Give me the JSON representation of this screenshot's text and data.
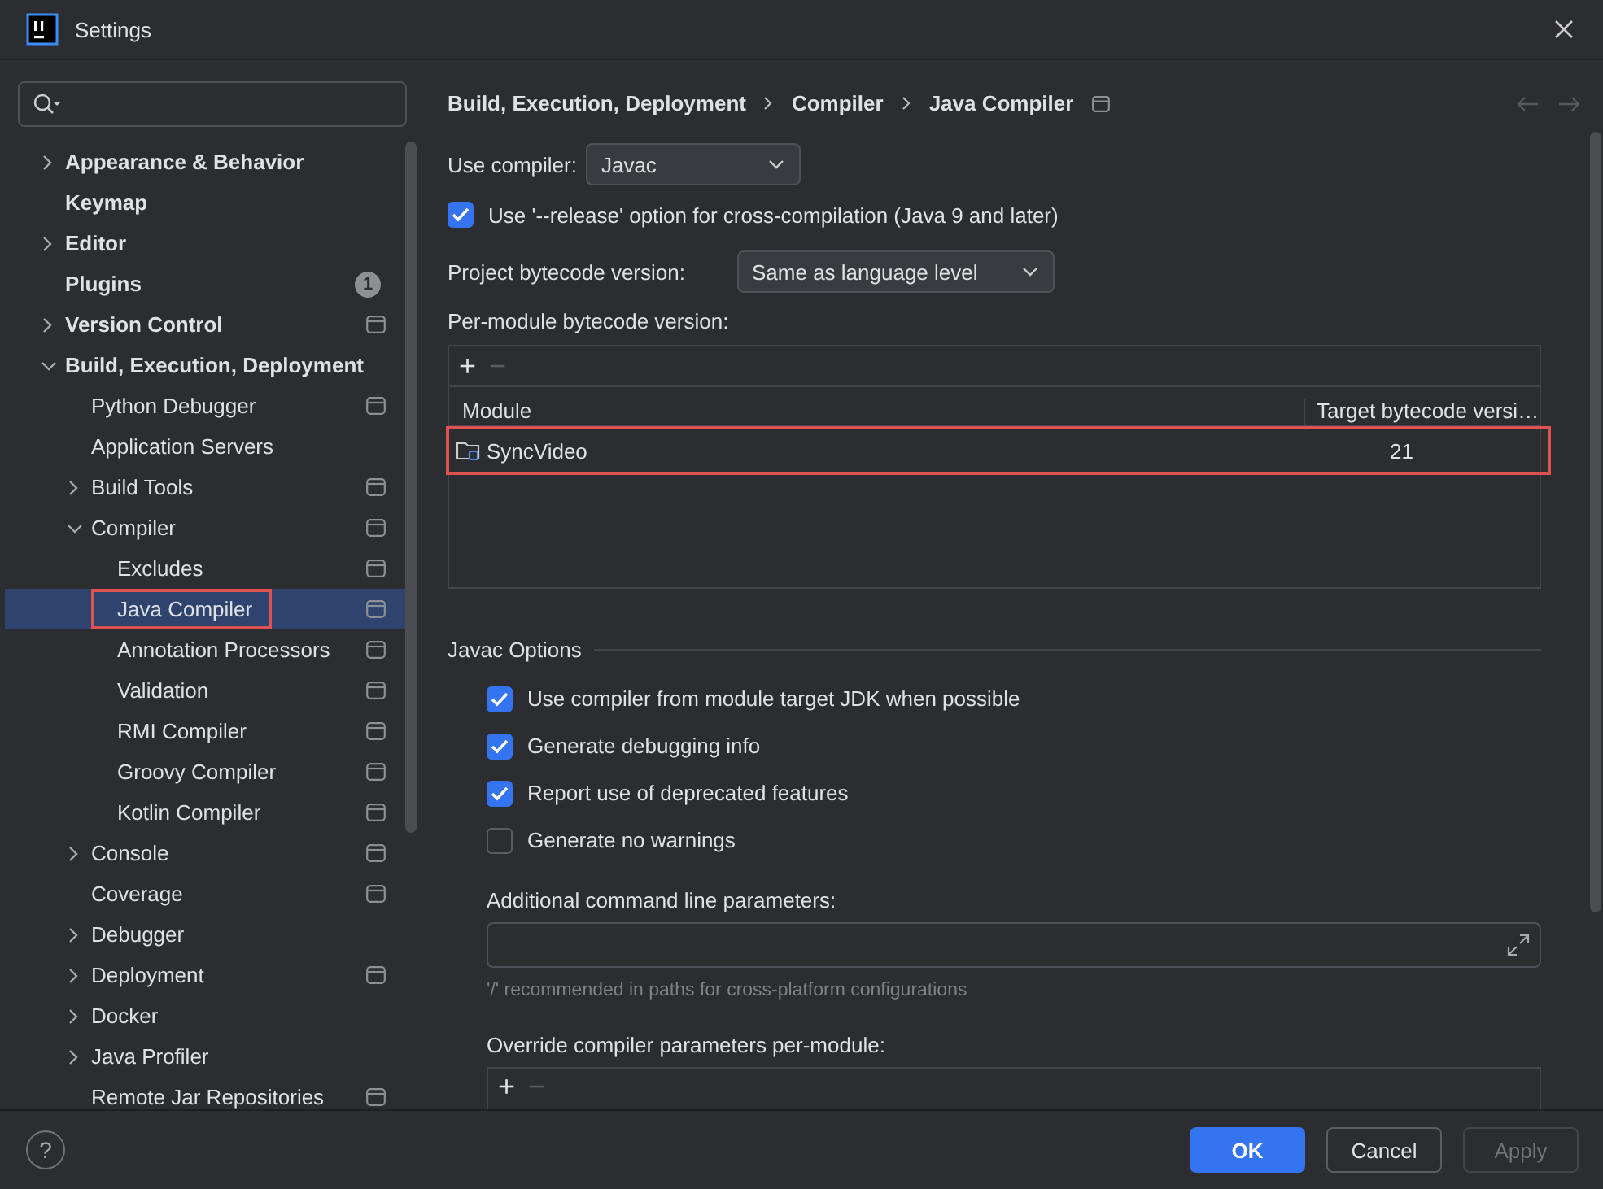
{
  "window": {
    "title": "Settings"
  },
  "sidebar": {
    "tree": [
      {
        "label": "Appearance & Behavior",
        "kind": "group",
        "expanded": false,
        "selected": false,
        "scoped": false
      },
      {
        "label": "Keymap",
        "kind": "leaf",
        "selected": false,
        "scoped": false
      },
      {
        "label": "Editor",
        "kind": "group",
        "expanded": false,
        "selected": false,
        "scoped": false
      },
      {
        "label": "Plugins",
        "kind": "leaf",
        "selected": false,
        "scoped": false,
        "badge": "1"
      },
      {
        "label": "Version Control",
        "kind": "group",
        "expanded": false,
        "selected": false,
        "scoped": true
      },
      {
        "label": "Build, Execution, Deployment",
        "kind": "group",
        "expanded": true,
        "selected": false,
        "scoped": false,
        "children": [
          {
            "label": "Python Debugger",
            "kind": "leaf",
            "selected": false,
            "scoped": true
          },
          {
            "label": "Application Servers",
            "kind": "leaf",
            "selected": false,
            "scoped": false
          },
          {
            "label": "Build Tools",
            "kind": "group",
            "expanded": false,
            "selected": false,
            "scoped": true
          },
          {
            "label": "Compiler",
            "kind": "group",
            "expanded": true,
            "selected": false,
            "scoped": true,
            "children": [
              {
                "label": "Excludes",
                "kind": "leaf",
                "selected": false,
                "scoped": true
              },
              {
                "label": "Java Compiler",
                "kind": "leaf",
                "selected": true,
                "scoped": true,
                "boxed": true
              },
              {
                "label": "Annotation Processors",
                "kind": "leaf",
                "selected": false,
                "scoped": true
              },
              {
                "label": "Validation",
                "kind": "leaf",
                "selected": false,
                "scoped": true
              },
              {
                "label": "RMI Compiler",
                "kind": "leaf",
                "selected": false,
                "scoped": true
              },
              {
                "label": "Groovy Compiler",
                "kind": "leaf",
                "selected": false,
                "scoped": true
              },
              {
                "label": "Kotlin Compiler",
                "kind": "leaf",
                "selected": false,
                "scoped": true
              }
            ]
          },
          {
            "label": "Console",
            "kind": "group",
            "expanded": false,
            "selected": false,
            "scoped": true
          },
          {
            "label": "Coverage",
            "kind": "leaf",
            "selected": false,
            "scoped": true
          },
          {
            "label": "Debugger",
            "kind": "group",
            "expanded": false,
            "selected": false,
            "scoped": false
          },
          {
            "label": "Deployment",
            "kind": "group",
            "expanded": false,
            "selected": false,
            "scoped": true
          },
          {
            "label": "Docker",
            "kind": "group",
            "expanded": false,
            "selected": false,
            "scoped": false
          },
          {
            "label": "Java Profiler",
            "kind": "group",
            "expanded": false,
            "selected": false,
            "scoped": false
          },
          {
            "label": "Remote Jar Repositories",
            "kind": "leaf",
            "selected": false,
            "scoped": true
          }
        ]
      }
    ]
  },
  "breadcrumb": [
    "Build, Execution, Deployment",
    "Compiler",
    "Java Compiler"
  ],
  "use_compiler": {
    "label": "Use compiler:",
    "value": "Javac"
  },
  "release_option": {
    "label": "Use '--release' option for cross-compilation (Java 9 and later)",
    "checked": true
  },
  "project_bytecode": {
    "label": "Project bytecode version:",
    "value": "Same as language level"
  },
  "per_module": {
    "label": "Per-module bytecode version:",
    "toolbar": [
      "+",
      "−"
    ],
    "columns": [
      "Module",
      "Target bytecode versi…"
    ],
    "rows": [
      {
        "module": "SyncVideo",
        "target": "21",
        "boxed": true
      }
    ]
  },
  "javac_options": {
    "title": "Javac Options",
    "options": [
      {
        "label": "Use compiler from module target JDK when possible",
        "checked": true
      },
      {
        "label": "Generate debugging info",
        "checked": true
      },
      {
        "label": "Report use of deprecated features",
        "checked": true
      },
      {
        "label": "Generate no warnings",
        "checked": false
      }
    ],
    "additional": {
      "label": "Additional command line parameters:",
      "hint": "'/' recommended in paths for cross-platform configurations"
    },
    "override": {
      "label": "Override compiler parameters per-module:",
      "toolbar": [
        "+",
        "−"
      ]
    }
  },
  "help": "?",
  "buttons": [
    {
      "label": "OK",
      "kind": "primary"
    },
    {
      "label": "Cancel",
      "kind": "normal"
    },
    {
      "label": "Apply",
      "kind": "disabled"
    }
  ]
}
